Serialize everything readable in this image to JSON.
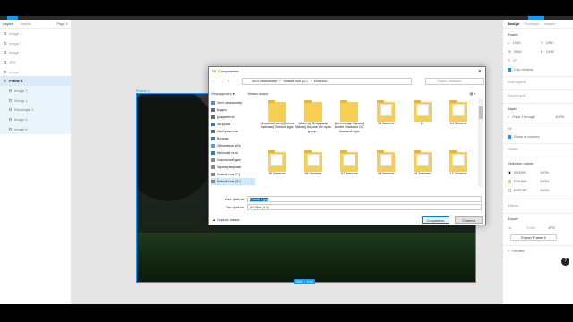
{
  "left_panel": {
    "tabs": [
      "Layers",
      "Assets"
    ],
    "page": "Page 1",
    "layers": [
      {
        "name": "Image 3",
        "kind": "normal"
      },
      {
        "name": "Image 2",
        "kind": "normal"
      },
      {
        "name": "Image 1",
        "kind": "normal"
      },
      {
        "name": "JPG",
        "kind": "normal"
      },
      {
        "name": "Image 4",
        "kind": "normal"
      },
      {
        "name": "Frame 4",
        "kind": "frame"
      },
      {
        "name": "Image 7",
        "kind": "child"
      },
      {
        "name": "Group 1",
        "kind": "child"
      },
      {
        "name": "Rectangle 1",
        "kind": "child"
      },
      {
        "name": "Image 5",
        "kind": "child"
      },
      {
        "name": "Image 6",
        "kind": "child"
      }
    ]
  },
  "canvas": {
    "frame_label": "Frame 4",
    "frame_dimensions": "2560 × 1440"
  },
  "right_panel": {
    "tabs": [
      "Design",
      "Prototype",
      "Inspect"
    ],
    "frame_section": "Frame",
    "x": "1946",
    "y": "1997",
    "w": "2560",
    "h": "1440",
    "clip_content": "Clip content",
    "auto_layout": "Auto layout",
    "layout_grid": "Layout grid",
    "layer_section": "Layer",
    "blend_mode": "Pass Through",
    "opacity": "100%",
    "fill_section": "Fill",
    "show_in_exports": "Show in exports",
    "stroke_section": "Stroke",
    "selection_colors": "Selection colors",
    "colors": [
      {
        "hex": "000000",
        "pct": "100%",
        "swatch": "#000000"
      },
      {
        "hex": "FFD800",
        "pct": "100%",
        "swatch": "#ffd800"
      },
      {
        "hex": "FFFFFF",
        "pct": "100%",
        "swatch": "#ffffff"
      }
    ],
    "effects": "Effects",
    "export_section": "Export",
    "export_scale": "1x",
    "export_suffix": "Suffix",
    "export_format": "JPG",
    "export_button": "Export Frame 4",
    "preview": "Preview",
    "help": "?"
  },
  "dialog": {
    "title": "Сохранение",
    "close": "✕",
    "breadcrumb": [
      "Этот компьютер",
      "Новый том (G:)",
      "Downlod"
    ],
    "search_placeholder": "Поиск: Downlod",
    "organize": "Упорядочить ▾",
    "new_folder": "Новая папка",
    "tree": [
      {
        "label": "Этот компьютер",
        "color": "#4a90d9",
        "selected": false
      },
      {
        "label": "Видео",
        "color": "#6a6a6a",
        "selected": false
      },
      {
        "label": "Документы",
        "color": "#6a6a6a",
        "selected": false
      },
      {
        "label": "Загрузки",
        "color": "#2a7ad5",
        "selected": false
      },
      {
        "label": "Изображения",
        "color": "#6a6a6a",
        "selected": false
      },
      {
        "label": "Музыка",
        "color": "#2a7ad5",
        "selected": false
      },
      {
        "label": "Объемные объ",
        "color": "#4aa3df",
        "selected": false
      },
      {
        "label": "Рабочий стол",
        "color": "#2a7ad5",
        "selected": false
      },
      {
        "label": "Локальный дис",
        "color": "#888888",
        "selected": false
      },
      {
        "label": "Зарезервирова",
        "color": "#888888",
        "selected": false
      },
      {
        "label": "Новый том (F:)",
        "color": "#888888",
        "selected": false
      },
      {
        "label": "Новый том (G:)",
        "color": "#888888",
        "selected": true
      }
    ],
    "items": [
      {
        "label": "[divyablad.com] [Елена Панкова] Полный курс ...",
        "type": "folder"
      },
      {
        "label": "[Udemy] [Владимир Минин] Angular 6 с нуля до пр...",
        "type": "folder"
      },
      {
        "label": "[Александр Сараев] Adobe Illustrator CC. Базовый курс",
        "type": "folder"
      },
      {
        "label": "01 Занятие",
        "type": "doc-folder"
      },
      {
        "label": "1с",
        "type": "doc-folder"
      },
      {
        "label": "04 Занятие",
        "type": "doc-folder"
      },
      {
        "label": "05 Занятие",
        "type": "doc-folder"
      },
      {
        "label": "06 Занятие",
        "type": "doc-folder"
      },
      {
        "label": "07 Занятие",
        "type": "doc-folder"
      },
      {
        "label": "08 Занятие",
        "type": "doc-folder"
      },
      {
        "label": "09 Занятие",
        "type": "doc-folder"
      },
      {
        "label": "10 Занятие",
        "type": "doc-folder"
      }
    ],
    "filename_label": "Имя файла:",
    "filename_value": "Frame 4.jpg",
    "filetype_label": "Тип файла:",
    "filetype_value": "All Files (*.*)",
    "hide_folders": "▲ Скрыть папки",
    "save_button": "Сохранить",
    "cancel_button": "Отмена"
  }
}
